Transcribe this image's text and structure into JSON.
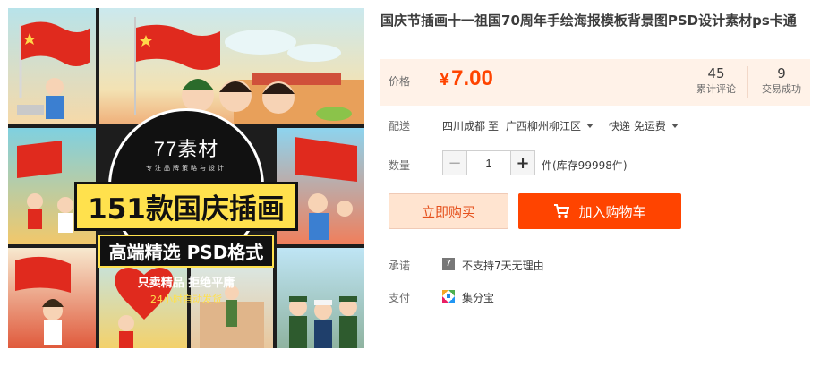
{
  "product": {
    "title": "国庆节插画十一祖国70周年手绘海报模板背景图PSD设计素材ps卡通"
  },
  "image": {
    "brand": "77素材",
    "brand_sub": "专注品牌策略与设计",
    "headline": "151款国庆插画",
    "subline": "高端精选 PSD格式",
    "subline2": "只卖精品 拒绝平庸",
    "subline3": "24小时自动发货"
  },
  "price": {
    "label": "价格",
    "currency": "¥",
    "amount": "7.00",
    "reviews_count": "45",
    "reviews_label": "累计评论",
    "sales_count": "9",
    "sales_label": "交易成功"
  },
  "shipping": {
    "label": "配送",
    "from": "四川成都",
    "to_word": "至",
    "to": "广西柳州柳江区",
    "method": "快递 免运费"
  },
  "quantity": {
    "label": "数量",
    "minus": "−",
    "value": "1",
    "plus": "+",
    "stock_text": "件(库存99998件)"
  },
  "actions": {
    "buy_now": "立即购买",
    "add_to_cart": "加入购物车"
  },
  "promise": {
    "label": "承诺",
    "icon_glyph": "7",
    "text": "不支持7天无理由"
  },
  "payment": {
    "label": "支付",
    "text": "集分宝"
  },
  "colors": {
    "accent": "#ff4400",
    "price_bg": "#fff2e8"
  }
}
